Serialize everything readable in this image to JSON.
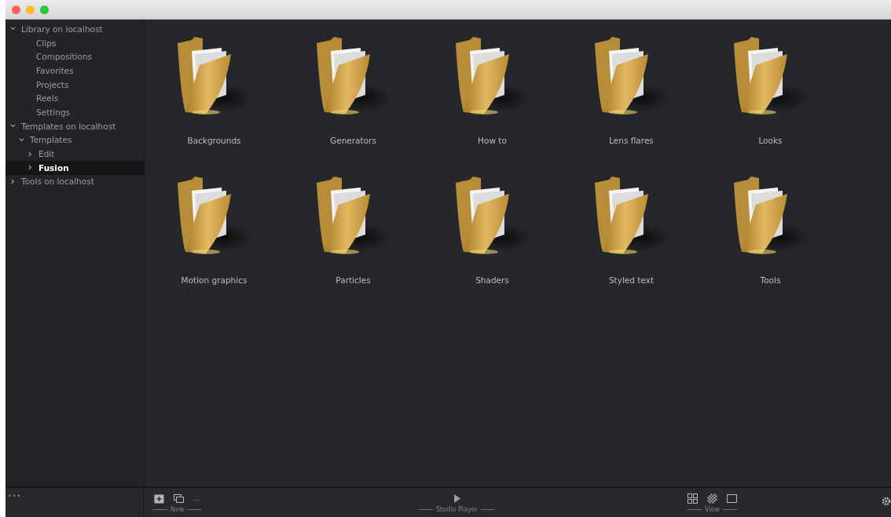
{
  "sidebar": {
    "tree": [
      {
        "label": "Library on localhost",
        "expanded": true,
        "selected": false,
        "children": [
          {
            "label": "Clips",
            "selected": false
          },
          {
            "label": "Compositions",
            "selected": false
          },
          {
            "label": "Favorites",
            "selected": false
          },
          {
            "label": "Projects",
            "selected": false
          },
          {
            "label": "Reels",
            "selected": false
          },
          {
            "label": "Settings",
            "selected": false
          }
        ]
      },
      {
        "label": "Templates on localhost",
        "expanded": true,
        "selected": false,
        "children": [
          {
            "label": "Templates",
            "expanded": true,
            "selected": false,
            "children": [
              {
                "label": "Edit",
                "expanded": false,
                "selected": false
              },
              {
                "label": "Fusion",
                "expanded": false,
                "selected": true
              }
            ]
          }
        ]
      },
      {
        "label": "Tools on localhost",
        "expanded": false,
        "selected": false
      }
    ],
    "footer": "•••"
  },
  "folders": [
    {
      "label": "Backgrounds"
    },
    {
      "label": "Generators"
    },
    {
      "label": "How to"
    },
    {
      "label": "Lens flares"
    },
    {
      "label": "Looks"
    },
    {
      "label": "Motion graphics"
    },
    {
      "label": "Particles"
    },
    {
      "label": "Shaders"
    },
    {
      "label": "Styled text"
    },
    {
      "label": "Tools"
    }
  ],
  "toolbar": {
    "groups": [
      {
        "label": "New",
        "items": [
          {
            "kind": "add-folder"
          },
          {
            "kind": "stack"
          },
          {
            "kind": "more",
            "text": "..."
          }
        ]
      },
      {
        "label": "Studio Player",
        "items": [
          {
            "kind": "play"
          }
        ]
      },
      {
        "label": "View",
        "items": [
          {
            "kind": "grid"
          },
          {
            "kind": "checker"
          },
          {
            "kind": "square"
          }
        ]
      }
    ]
  }
}
